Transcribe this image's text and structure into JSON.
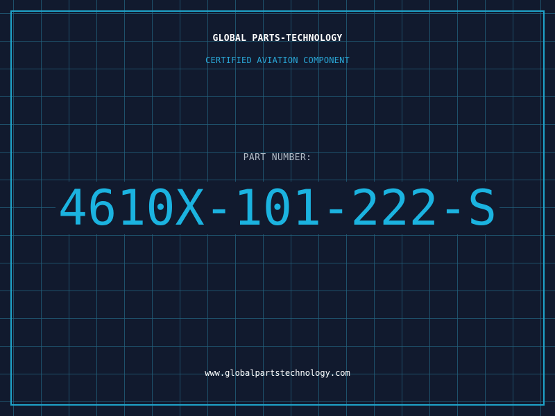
{
  "header": {
    "company": "GLOBAL PARTS-TECHNOLOGY",
    "tagline": "CERTIFIED AVIATION COMPONENT"
  },
  "part": {
    "label": "PART NUMBER:",
    "number": "4610X-101-222-S"
  },
  "footer": {
    "website": "www.globalpartstechnology.com"
  },
  "colors": {
    "background": "#111a2e",
    "grid": "#23627d",
    "frame": "#1fa3c9",
    "accent": "#1bb3e0",
    "heading": "#ffffff",
    "label": "#b3bdc8"
  }
}
